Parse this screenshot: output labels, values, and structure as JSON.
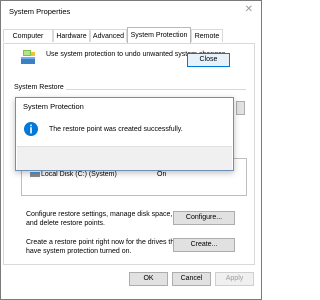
{
  "window": {
    "title": "System Properties"
  },
  "tabs": [
    {
      "label": "Computer Name"
    },
    {
      "label": "Hardware"
    },
    {
      "label": "Advanced"
    },
    {
      "label": "System Protection"
    },
    {
      "label": "Remote"
    }
  ],
  "main": {
    "intro": "Use system protection to undo unwanted system changes.",
    "section_label": "System Restore",
    "drive": {
      "name": "Local Disk (C:) (System)",
      "status": "On"
    },
    "configure_text_1": "Configure restore settings, manage disk space,",
    "configure_text_2": "and delete restore points.",
    "configure_button": "Configure...",
    "create_text_1": "Create a restore point right now for the drives that",
    "create_text_2": "have system protection turned on.",
    "create_button": "Create..."
  },
  "footer": {
    "ok": "OK",
    "cancel": "Cancel",
    "apply": "Apply"
  },
  "dialog": {
    "title": "System Protection",
    "message": "The restore point was created successfully.",
    "close_button": "Close"
  },
  "colors": {
    "accent": "#0078d7",
    "info_icon": "#0078d7"
  }
}
